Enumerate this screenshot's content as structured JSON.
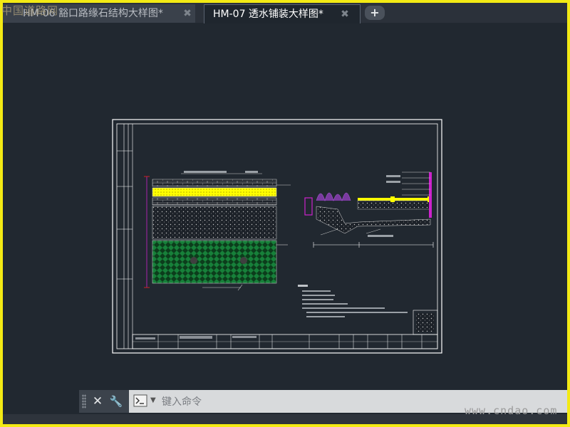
{
  "tabs": [
    {
      "label": "HM-06 豁口路缘石结构大样图*",
      "close": "✖",
      "active": false
    },
    {
      "label": "HM-07 透水铺装大样图*",
      "close": "✖",
      "active": true
    }
  ],
  "new_tab_label": "+",
  "watermarks": {
    "top_left": "中国道路网",
    "bottom_right": "www.cndao.com"
  },
  "command_line": {
    "placeholder": "键入命令",
    "close_icon": "close-icon",
    "customize_icon": "wrench-icon",
    "prompt_icon": "command-prompt-icon"
  },
  "colors": {
    "background": "#212830",
    "sheet_border": "#ffffff",
    "highlight_border": "#f3ea14",
    "hatch_yellow": "#ffff00",
    "hatch_green": "#0f6b2f",
    "magenta": "#cc22cc",
    "cyan": "#22cccc"
  }
}
